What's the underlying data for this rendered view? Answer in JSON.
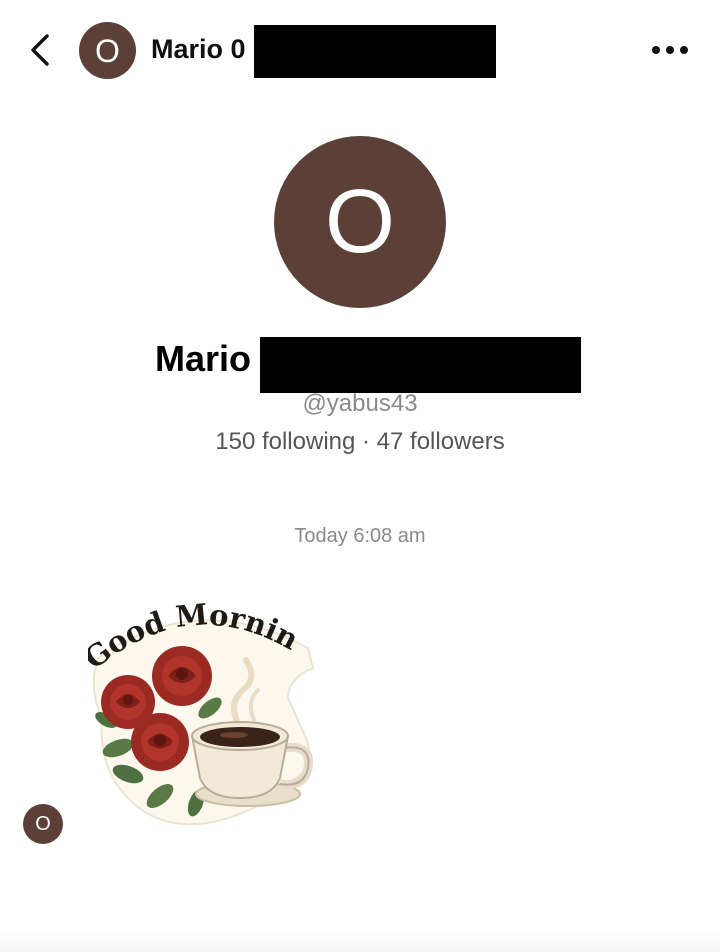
{
  "header": {
    "avatar_initial": "O",
    "name": "Mario 0"
  },
  "profile": {
    "avatar_initial": "O",
    "name": "Mario",
    "handle": "@yabus43",
    "stats": "150 following · 47 followers"
  },
  "messages": {
    "timestamp": "Today 6:08 am",
    "sender_initial": "O",
    "sticker_text": "Good Morning"
  }
}
